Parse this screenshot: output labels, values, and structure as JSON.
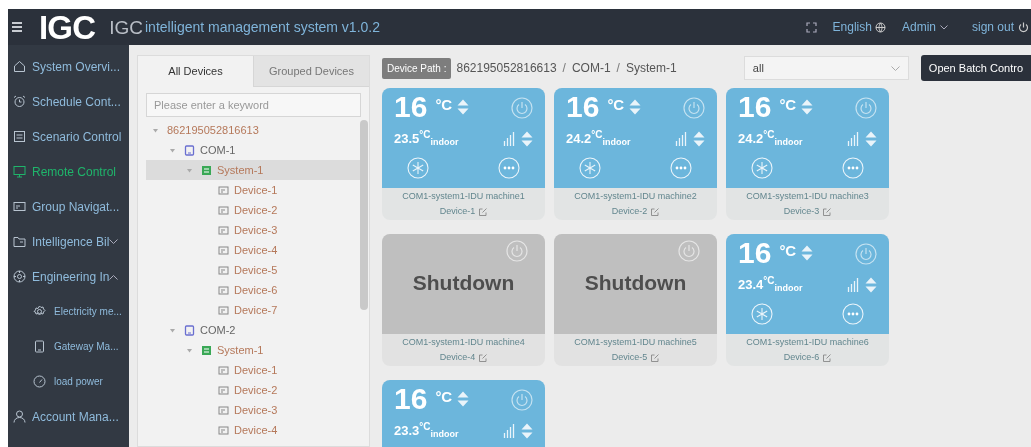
{
  "header": {
    "logo": "IGC",
    "title_prefix": "IGC",
    "title": "intelligent management system v1.0.2",
    "language": "English",
    "user": "Admin",
    "sign_out": "sign out"
  },
  "sidebar": {
    "items": [
      {
        "label": "System Overvi...",
        "selected": false
      },
      {
        "label": "Schedule Cont...",
        "selected": false
      },
      {
        "label": "Scenario Control",
        "selected": false
      },
      {
        "label": "Remote Control",
        "selected": true
      },
      {
        "label": "Group Navigat...",
        "selected": false
      },
      {
        "label": "Intelligence Bil",
        "selected": false,
        "expanded": false
      },
      {
        "label": "Engineering In",
        "selected": false,
        "expanded": true,
        "children": [
          {
            "label": "Electricity me...",
            "selected": false
          },
          {
            "label": "Gateway Ma...",
            "selected": false
          },
          {
            "label": "load power",
            "selected": false
          }
        ]
      },
      {
        "label": "Account Mana...",
        "selected": false
      }
    ]
  },
  "tree_panel": {
    "tabs": [
      {
        "label": "All Devices",
        "selected": true
      },
      {
        "label": "Grouped Devices",
        "selected": false
      }
    ],
    "search": {
      "placeholder": "Please enter a keyword"
    },
    "tree": [
      {
        "kind": "gateway",
        "label": "862195052816613",
        "expanded": true,
        "selected": false,
        "children": [
          {
            "kind": "com",
            "label": "COM-1",
            "expanded": true,
            "selected": false,
            "children": [
              {
                "kind": "system",
                "label": "System-1",
                "expanded": true,
                "selected": true,
                "children": [
                  {
                    "kind": "device",
                    "label": "Device-1",
                    "selected": false
                  },
                  {
                    "kind": "device",
                    "label": "Device-2",
                    "selected": false
                  },
                  {
                    "kind": "device",
                    "label": "Device-3",
                    "selected": false
                  },
                  {
                    "kind": "device",
                    "label": "Device-4",
                    "selected": false
                  },
                  {
                    "kind": "device",
                    "label": "Device-5",
                    "selected": false
                  },
                  {
                    "kind": "device",
                    "label": "Device-6",
                    "selected": false
                  },
                  {
                    "kind": "device",
                    "label": "Device-7",
                    "selected": false
                  }
                ]
              }
            ]
          },
          {
            "kind": "com",
            "label": "COM-2",
            "expanded": true,
            "selected": false,
            "children": [
              {
                "kind": "system",
                "label": "System-1",
                "expanded": true,
                "selected": false,
                "children": [
                  {
                    "kind": "device",
                    "label": "Device-1",
                    "selected": false
                  },
                  {
                    "kind": "device",
                    "label": "Device-2",
                    "selected": false
                  },
                  {
                    "kind": "device",
                    "label": "Device-3",
                    "selected": false
                  },
                  {
                    "kind": "device",
                    "label": "Device-4",
                    "selected": false
                  }
                ]
              }
            ]
          }
        ]
      }
    ]
  },
  "toolbar": {
    "path_label": "Device Path :",
    "path": [
      "862195052816613",
      "COM-1",
      "System-1"
    ],
    "path_separator": "/",
    "filter": {
      "value": "all"
    },
    "batch_button": "Open Batch Contro"
  },
  "cards": [
    {
      "kind": "on",
      "setpoint": "16",
      "unit": "°C",
      "indoor": "23.5$^{°C}$$_{indoor}$",
      "name": "COM1-system1-IDU machine1",
      "device": "Device-1"
    },
    {
      "kind": "on",
      "setpoint": "16",
      "unit": "°C",
      "indoor": "24.2$^{°C}$$_{indoor}$",
      "name": "COM1-system1-IDU machine2",
      "device": "Device-2"
    },
    {
      "kind": "on",
      "setpoint": "16",
      "unit": "°C",
      "indoor": "24.2$^{°C}$$_{indoor}$",
      "name": "COM1-system1-IDU machine3",
      "device": "Device-3"
    },
    {
      "kind": "off",
      "status": "Shutdown",
      "name": "COM1-system1-IDU machine4",
      "device": "Device-4"
    },
    {
      "kind": "off",
      "status": "Shutdown",
      "name": "COM1-system1-IDU machine5",
      "device": "Device-5"
    },
    {
      "kind": "on",
      "setpoint": "16",
      "unit": "°C",
      "indoor": "23.4$^{°C}$$_{indoor}$",
      "name": "COM1-system1-IDU machine6",
      "device": "Device-6"
    },
    {
      "kind": "on",
      "setpoint": "16",
      "unit": "°C",
      "indoor": "23.3$^{°C}$$_{indoor}$"
    }
  ]
}
